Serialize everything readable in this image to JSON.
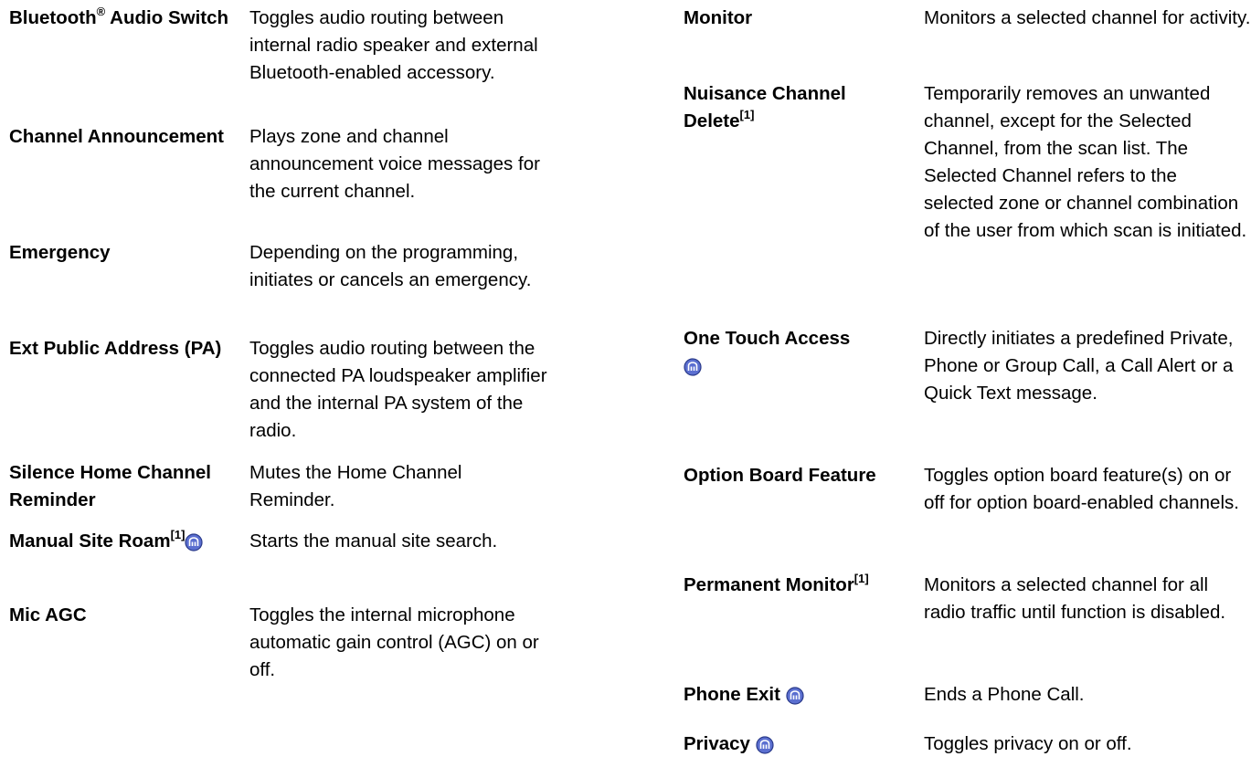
{
  "left": [
    {
      "term": "Bluetooth",
      "sup": "®",
      "term_rest": " Audio Switch",
      "desc": "Toggles audio routing between internal radio speaker and external Bluetooth-enabled accessory."
    },
    {
      "term": "Channel Announcement",
      "desc": "Plays zone and channel announcement voice messages for the current channel."
    },
    {
      "term": "Emergency",
      "desc": "Depending on the programming, initiates or cancels an emergency."
    },
    {
      "term": "Ext Public Address (PA)",
      "desc": "Toggles audio routing between the connected PA loudspeaker amplifier and the internal PA system of the radio."
    },
    {
      "term": "Silence Home Channel Reminder",
      "desc": "Mutes the Home Channel Reminder."
    },
    {
      "term": "Manual Site Roam",
      "sup": "[1]",
      "icon": "trunking-feature-icon",
      "desc": "Starts the manual site search."
    },
    {
      "term": "Mic AGC",
      "desc": "Toggles the internal microphone automatic gain control (AGC) on or off."
    }
  ],
  "right": [
    {
      "term": "Monitor",
      "desc": "Monitors a selected channel for activity."
    },
    {
      "term": "Nuisance Channel Delete",
      "sup": "[1]",
      "desc": "Temporarily removes an unwanted channel, except for the Selected Channel, from the scan list. The Selected Channel refers to the selected zone or channel combination of the user from which scan is initiated."
    },
    {
      "term": "One Touch Access",
      "icon": "trunking-feature-icon",
      "desc": "Directly initiates a predefined Private, Phone or Group Call, a Call Alert or a Quick Text message."
    },
    {
      "term": "Option Board Feature",
      "desc": "Toggles option board feature(s) on or off for option board-enabled channels."
    },
    {
      "term": "Permanent Monitor",
      "sup": "[1]",
      "desc": "Monitors a selected channel for all radio traffic until function is disabled."
    },
    {
      "term": "Phone Exit",
      "icon": "trunking-feature-icon",
      "desc": "Ends a Phone Call."
    },
    {
      "term": "Privacy",
      "icon": "trunking-feature-icon",
      "desc": "Toggles privacy on or off."
    }
  ],
  "colors": {
    "icon_fill": "#5b6fd0",
    "icon_stroke": "#2a3a8a"
  }
}
